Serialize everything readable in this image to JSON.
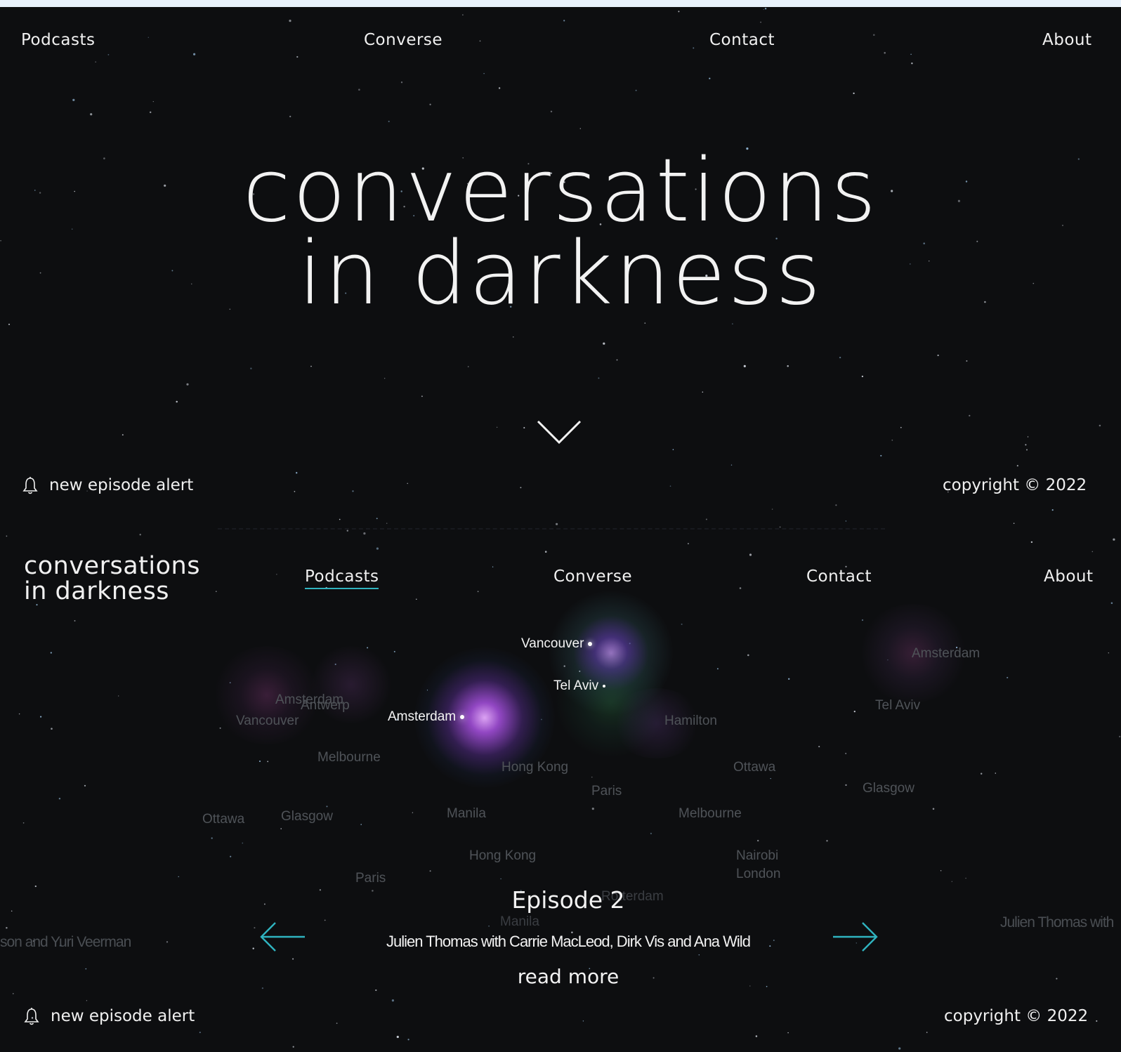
{
  "top_nav": {
    "podcasts": "Podcasts",
    "converse": "Converse",
    "contact": "Contact",
    "about": "About"
  },
  "hero": {
    "title_line1": "conversations",
    "title_line2": "in darkness"
  },
  "footer": {
    "alert": "new episode alert",
    "copyright": "copyright © 2022"
  },
  "section2": {
    "logo_line1": "conversations",
    "logo_line2": "in darkness",
    "nav": {
      "podcasts": "Podcasts",
      "converse": "Converse",
      "contact": "Contact",
      "about": "About"
    },
    "map_labels": {
      "vancouver_main": "Vancouver",
      "tel_aviv_main": "Tel Aviv",
      "amsterdam_main": "Amsterdam",
      "amsterdam_left": "Amsterdam",
      "antwerp": "Antwerp",
      "vancouver_left": "Vancouver",
      "melbourne_left": "Melbourne",
      "hong_kong_mid": "Hong Kong",
      "hamilton": "Hamilton",
      "ottawa_right": "Ottawa",
      "paris_mid": "Paris",
      "ottawa_left": "Ottawa",
      "glasgow_left": "Glasgow",
      "manila_mid": "Manila",
      "melbourne_right": "Melbourne",
      "amsterdam_far": "Amsterdam",
      "tel_aviv_far": "Tel Aviv",
      "glasgow_far": "Glasgow",
      "hong_kong_low": "Hong Kong",
      "nairobi": "Nairobi",
      "london": "London",
      "paris_low": "Paris",
      "rotterdam": "Rotterdam",
      "manila_low": "Manila"
    },
    "episode": {
      "title": "Episode 2",
      "subtitle": "Julien Thomas with Carrie MacLeod, Dirk Vis and Ana Wild",
      "read_more": "read more"
    },
    "prev_preview": "son and Yuri Veerman",
    "next_preview": "Julien Thomas with"
  },
  "colors": {
    "background": "#0d0e10",
    "text": "#f0f0f0",
    "accent_teal": "#2fb3bf",
    "glow_purple": "#c060ff"
  }
}
